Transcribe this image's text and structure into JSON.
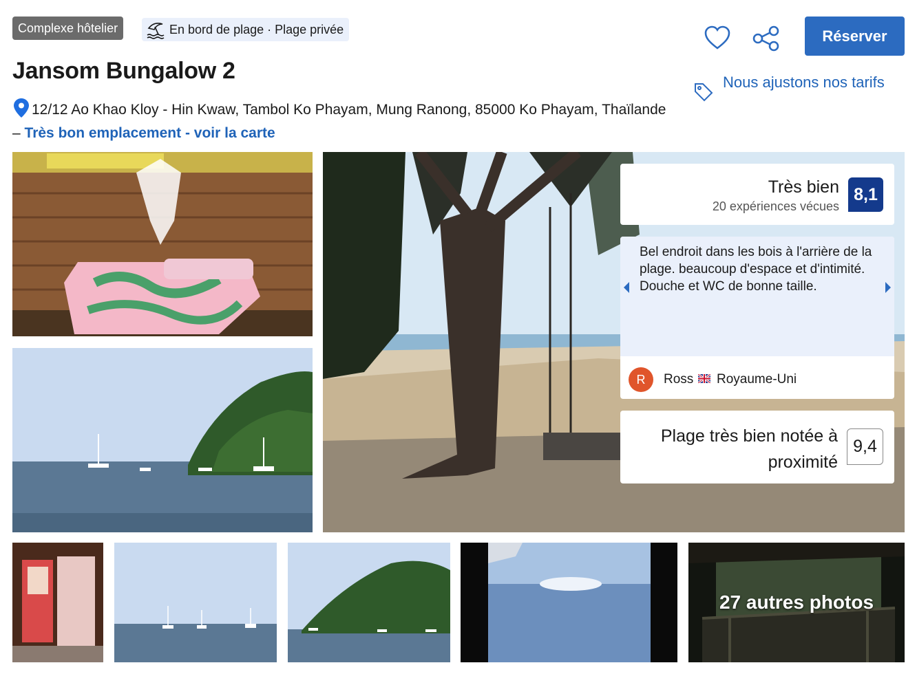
{
  "header": {
    "type_badge": "Complexe hôtelier",
    "beach_badge": "En bord de plage · Plage privée",
    "title": "Jansom Bungalow 2",
    "address": "12/12 Ao Khao Kloy - Hin Kwaw, Tambol Ko Phayam, Mung Ranong, 85000 Ko Phayam, Thaïlande –",
    "map_link": "Très bon emplacement - voir la carte"
  },
  "actions": {
    "favorite_icon": "heart-icon",
    "share_icon": "share-icon",
    "reserve_label": "Réserver",
    "price_note": "Nous ajustons nos tarifs",
    "price_icon": "tag-icon"
  },
  "rating": {
    "label": "Très bien",
    "count": "20 expériences vécues",
    "score": "8,1",
    "score_color": "#143a8c"
  },
  "review": {
    "text": "Bel endroit dans les bois à l'arrière de la plage. beaucoup d'espace et d'intimité. Douche et WC de bonne taille.",
    "avatar_initial": "R",
    "reviewer": "Ross",
    "country": "Royaume-Uni"
  },
  "beach": {
    "label": "Plage très bien notée à proximité",
    "score": "9,4"
  },
  "gallery": {
    "more_label": "27 autres photos"
  },
  "colors": {
    "brand_blue": "#2c6bc0",
    "link_blue": "#1f63b8",
    "badge_gray": "#6b6b6b",
    "badge_light": "#eaf0fb",
    "avatar": "#e0552b"
  }
}
